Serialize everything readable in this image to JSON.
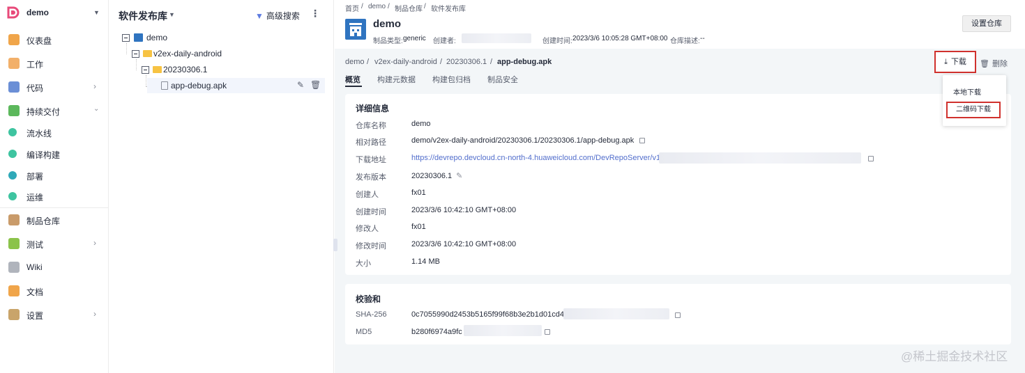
{
  "sidebar": {
    "project": "demo",
    "items": [
      {
        "label": "仪表盘",
        "icon": "dashboard-icon",
        "color": "#f0a54a"
      },
      {
        "label": "工作",
        "icon": "work-icon",
        "color": "#f2b06a"
      },
      {
        "label": "代码",
        "icon": "code-icon",
        "color": "#6b8fd6"
      },
      {
        "label": "持续交付",
        "icon": "delivery-icon",
        "color": "#5cb85c"
      },
      {
        "label": "流水线",
        "icon": "pipeline-icon",
        "color": "#3ec4a0"
      },
      {
        "label": "编译构建",
        "icon": "build-icon",
        "color": "#3ec4a0"
      },
      {
        "label": "部署",
        "icon": "deploy-icon",
        "color": "#2fa9b8"
      },
      {
        "label": "运维",
        "icon": "ops-icon",
        "color": "#3ec4a0"
      },
      {
        "label": "制品仓库",
        "icon": "artifact-icon",
        "color": "#c99b6a"
      },
      {
        "label": "测试",
        "icon": "test-icon",
        "color": "#8bc34a"
      },
      {
        "label": "Wiki",
        "icon": "wiki-icon",
        "color": "#b0b4bc"
      },
      {
        "label": "文档",
        "icon": "doc-icon",
        "color": "#f0a54a"
      },
      {
        "label": "设置",
        "icon": "settings-icon",
        "color": "#c9a46a"
      }
    ]
  },
  "tree": {
    "title": "软件发布库",
    "advanced_search": "高级搜索",
    "nodes": [
      "demo",
      "v2ex-daily-android",
      "20230306.1",
      "app-debug.apk"
    ]
  },
  "header": {
    "crumbs": [
      "首页",
      "demo",
      "制品仓库",
      "软件发布库"
    ],
    "repo_name": "demo",
    "type_label": "制品类型:",
    "type_value": "generic",
    "creator_label": "创建者:",
    "created_label": "创建时间:",
    "created_value": "2023/3/6 10:05:28 GMT+08:00",
    "desc_label": "仓库描述:",
    "desc_value": "--",
    "settings_button": "设置仓库"
  },
  "path": {
    "segments": [
      "demo",
      "v2ex-daily-android",
      "20230306.1"
    ],
    "current": "app-debug.apk"
  },
  "tabs": [
    "概览",
    "构建元数据",
    "构建包归档",
    "制品安全"
  ],
  "actions": {
    "download": "下载",
    "delete": "删除",
    "menu": [
      "本地下载",
      "二维码下载"
    ]
  },
  "details": {
    "title": "详细信息",
    "rows": [
      {
        "k": "仓库名称",
        "v": "demo"
      },
      {
        "k": "相对路径",
        "v": "demo/v2ex-daily-android/20230306.1/20230306.1/app-debug.apk"
      },
      {
        "k": "下载地址",
        "v": "https://devrepo.devcloud.cn-north-4.huaweicloud.com/DevRepoServer/v1/f"
      },
      {
        "k": "发布版本",
        "v": "20230306.1"
      },
      {
        "k": "创建人",
        "v": "fx01"
      },
      {
        "k": "创建时间",
        "v": "2023/3/6 10:42:10 GMT+08:00"
      },
      {
        "k": "修改人",
        "v": "fx01"
      },
      {
        "k": "修改时间",
        "v": "2023/3/6 10:42:10 GMT+08:00"
      },
      {
        "k": "大小",
        "v": "1.14 MB"
      }
    ]
  },
  "checksum": {
    "title": "校验和",
    "rows": [
      {
        "k": "SHA-256",
        "v": "0c7055990d2453b5165f99f68b3e2b1d01cd41"
      },
      {
        "k": "MD5",
        "v": "b280f6974a9fc"
      }
    ]
  },
  "watermark": "@稀土掘金技术社区"
}
